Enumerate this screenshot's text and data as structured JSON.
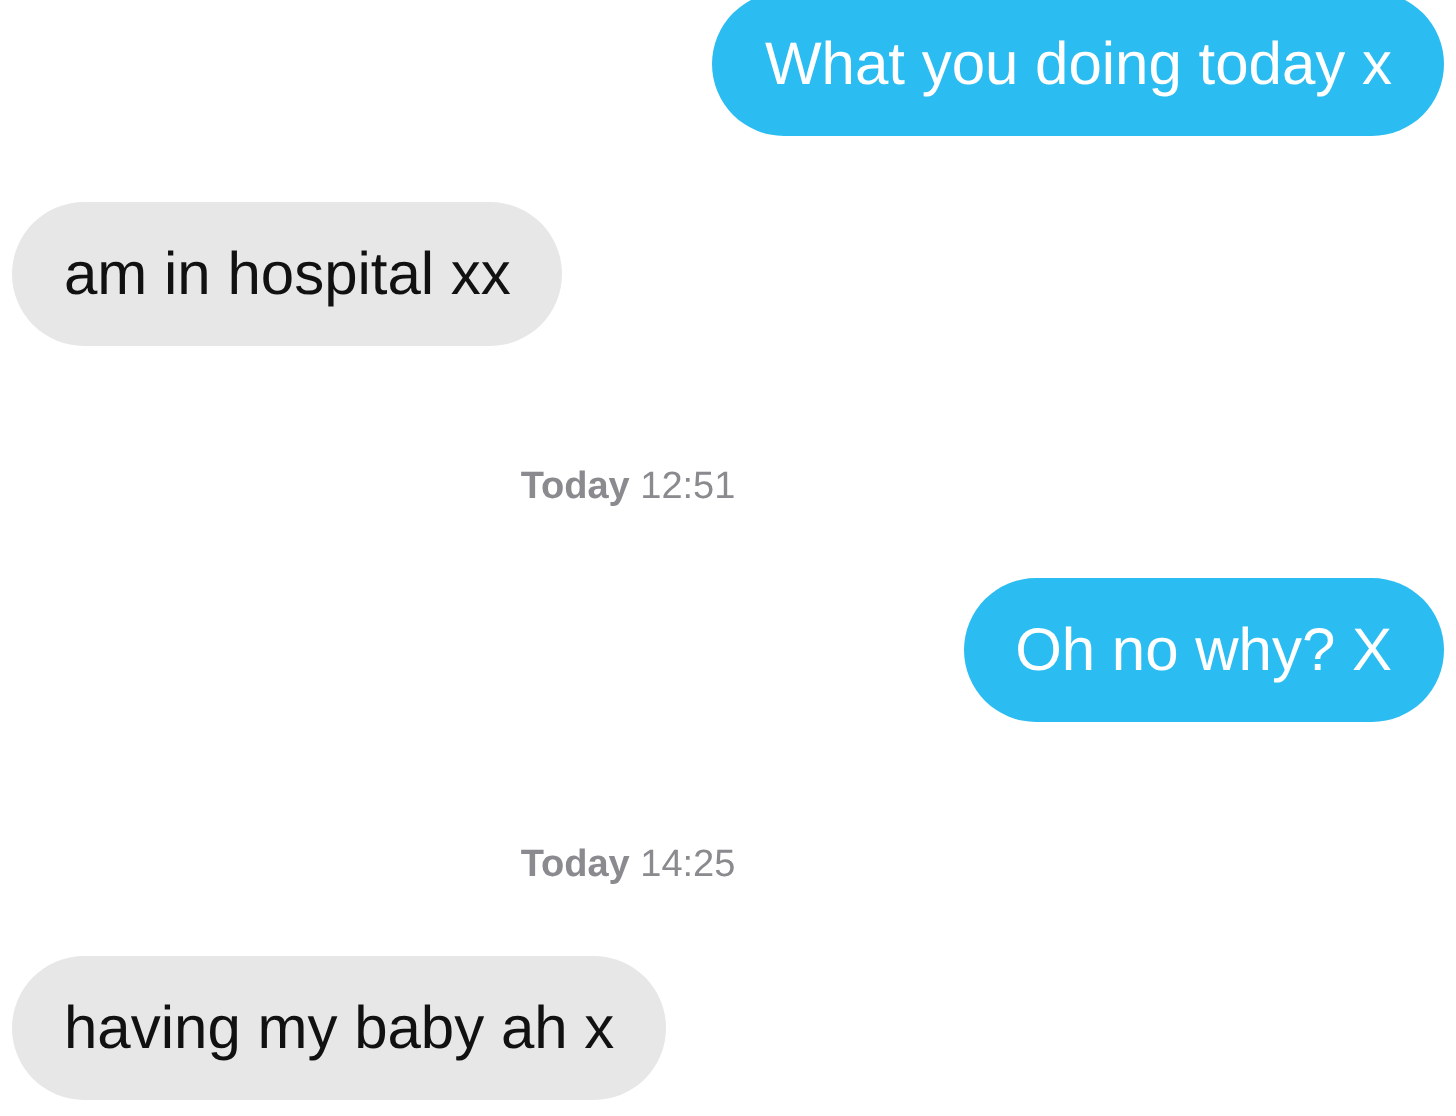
{
  "messages": [
    {
      "kind": "sent",
      "text": "What you doing today x"
    },
    {
      "kind": "received",
      "text": "am in hospital xx"
    },
    {
      "kind": "timestamp",
      "text": "**Today** 12:51"
    },
    {
      "kind": "sent",
      "text": "Oh no why? X"
    },
    {
      "kind": "timestamp",
      "text": "**Today** 14:25"
    },
    {
      "kind": "received",
      "text": "having my baby ah x"
    }
  ]
}
